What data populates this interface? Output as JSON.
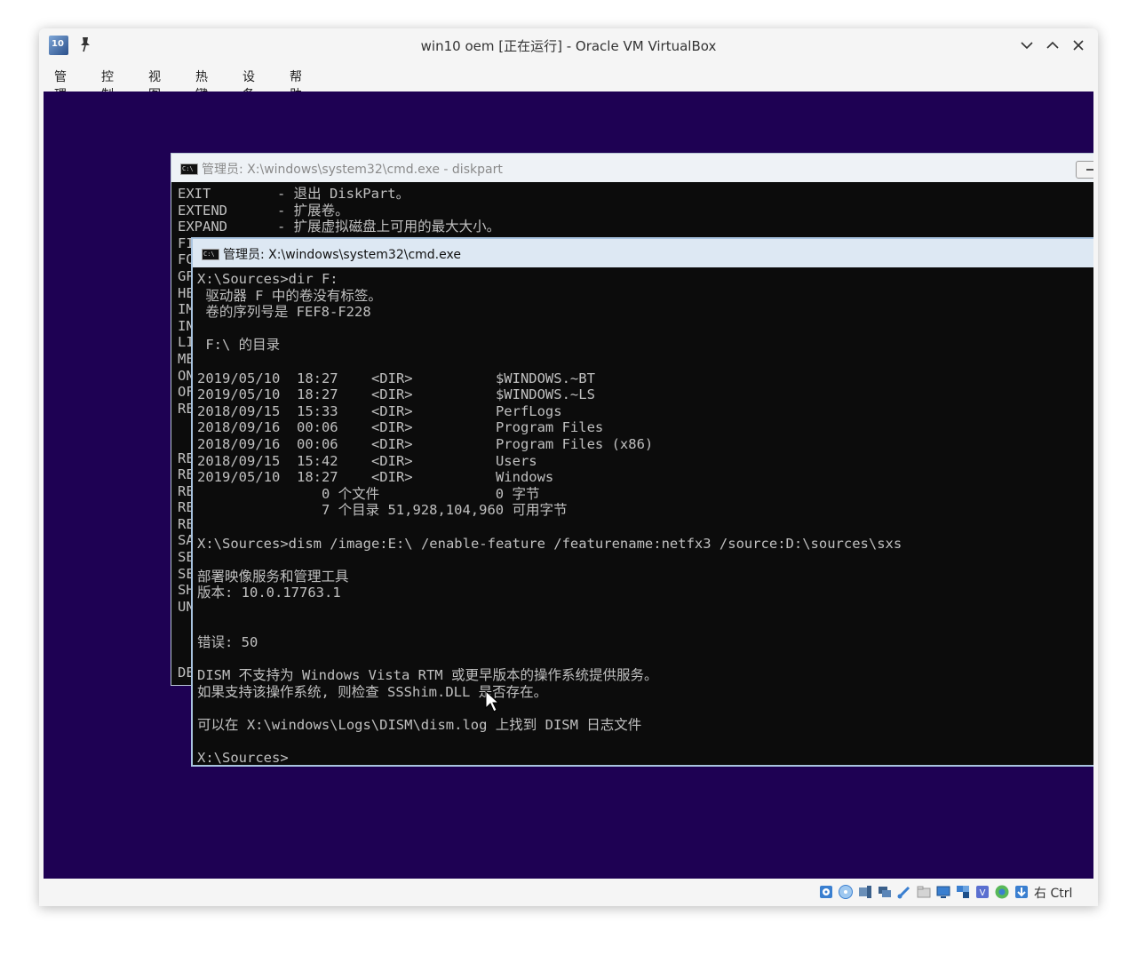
{
  "window": {
    "title": "win10 oem [正在运行] - Oracle VM VirtualBox",
    "app_icon_text": "10"
  },
  "menu": {
    "items": [
      {
        "label": "管理"
      },
      {
        "label": "控制"
      },
      {
        "label": "视图"
      },
      {
        "label": "热键"
      },
      {
        "label": "设备"
      },
      {
        "label": "帮助"
      }
    ]
  },
  "cmd_back": {
    "title": "管理员: X:\\windows\\system32\\cmd.exe - diskpart",
    "icon_text": "C:\\",
    "lines": [
      "EXIT        - 退出 DiskPart。",
      "EXTEND      - 扩展卷。",
      "EXPAND      - 扩展虚拟磁盘上可用的最大大小。",
      "FI",
      "FO",
      "GP",
      "HE",
      "IM",
      "IN",
      "LI",
      "ME",
      "ON",
      "OF",
      "RE",
      "",
      "",
      "RE",
      "RE",
      "RE",
      "RE",
      "RE",
      "SA",
      "SE",
      "SE",
      "SH",
      "UN",
      "",
      "",
      "",
      "DE"
    ]
  },
  "cmd_front": {
    "title": "管理员: X:\\windows\\system32\\cmd.exe",
    "icon_text": "C:\\",
    "lines": [
      "X:\\Sources>dir F:",
      " 驱动器 F 中的卷没有标签。",
      " 卷的序列号是 FEF8-F228",
      "",
      " F:\\ 的目录",
      "",
      "2019/05/10  18:27    <DIR>          $WINDOWS.~BT",
      "2019/05/10  18:27    <DIR>          $WINDOWS.~LS",
      "2018/09/15  15:33    <DIR>          PerfLogs",
      "2018/09/16  00:06    <DIR>          Program Files",
      "2018/09/16  00:06    <DIR>          Program Files (x86)",
      "2018/09/15  15:42    <DIR>          Users",
      "2019/05/10  18:27    <DIR>          Windows",
      "               0 个文件              0 字节",
      "               7 个目录 51,928,104,960 可用字节",
      "",
      "X:\\Sources>dism /image:E:\\ /enable-feature /featurename:netfx3 /source:D:\\sources\\sxs",
      "",
      "部署映像服务和管理工具",
      "版本: 10.0.17763.1",
      "",
      "",
      "错误: 50",
      "",
      "DISM 不支持为 Windows Vista RTM 或更早版本的操作系统提供服务。",
      "如果支持该操作系统, 则检查 SSShim.DLL 是否存在。",
      "",
      "可以在 X:\\windows\\Logs\\DISM\\dism.log 上找到 DISM 日志文件",
      "",
      "X:\\Sources>"
    ]
  },
  "statusbar": {
    "icons": [
      "hard-disk-icon",
      "optical-disk-icon",
      "audio-icon",
      "network-icon",
      "usb-icon",
      "shared-folder-icon",
      "display-icon",
      "video-capture-icon",
      "recording-icon",
      "cpu-icon",
      "mouse-integration-icon",
      "keyboard-capture-icon"
    ],
    "host_key": "右 Ctrl"
  },
  "colors": {
    "vm_background": "#1e0153",
    "console_background": "#0c0c0c",
    "console_text": "#c0c0c0",
    "active_titlebar": "#dde8f3",
    "inactive_title_text": "#8a8a8a"
  }
}
